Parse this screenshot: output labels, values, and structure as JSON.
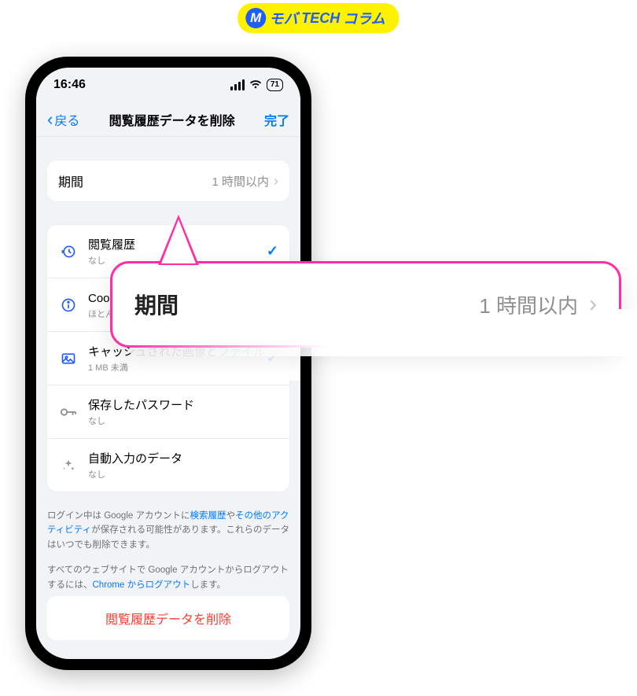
{
  "logo": {
    "mark": "M",
    "part1": "モバ",
    "part2": "TECH",
    "part3": "コラム"
  },
  "status": {
    "time": "16:46",
    "battery": "71"
  },
  "nav": {
    "back": "戻る",
    "title": "閲覧履歴データを削除",
    "done": "完了"
  },
  "period_row": {
    "label": "期間",
    "value": "1 時間以内"
  },
  "items": [
    {
      "title": "閲覧履歴",
      "sub": "なし",
      "checked": true,
      "icon": "history",
      "muted": false
    },
    {
      "title": "Cookie、サイトデータ",
      "sub": "ほとんどのサイトからログアウトします。",
      "checked": true,
      "icon": "info",
      "muted": false
    },
    {
      "title": "キャッシュされた画像とファイル",
      "sub": "1 MB 未満",
      "checked": true,
      "icon": "image",
      "muted": false
    },
    {
      "title": "保存したパスワード",
      "sub": "なし",
      "checked": false,
      "icon": "key",
      "muted": true
    },
    {
      "title": "自動入力のデータ",
      "sub": "なし",
      "checked": false,
      "icon": "sparkle",
      "muted": true
    }
  ],
  "footer": {
    "p1a": "ログイン中は Google アカウントに",
    "p1_link1": "検索履歴",
    "p1b": "や",
    "p1_link2": "その他のアクティビティ",
    "p1c": "が保存される可能性があります。これらのデータはいつでも削除できます。",
    "p2a": "すべてのウェブサイトで Google アカウントからログアウトするには、",
    "p2_link": "Chrome からログアウト",
    "p2b": "します。"
  },
  "delete_button": "閲覧履歴データを削除",
  "callout": {
    "label": "期間",
    "value": "1 時間以内"
  }
}
